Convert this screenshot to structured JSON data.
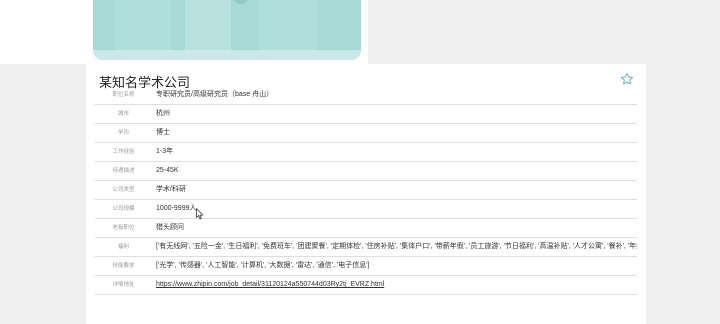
{
  "company": {
    "name": "某知名学术公司"
  },
  "colors": {
    "accent_star": "#5ab9c0",
    "hero_teal": "#a7d9d7"
  },
  "icons": {
    "favorite": "star-outline-icon",
    "cursor": "mouse-pointer-icon"
  },
  "details": [
    {
      "label": "职位名称",
      "value": "专职研究员/高级研究员（base 舟山）"
    },
    {
      "label": "城市",
      "value": "杭州"
    },
    {
      "label": "学历",
      "value": "博士"
    },
    {
      "label": "工作经验",
      "value": "1-3年"
    },
    {
      "label": "待遇描述",
      "value": "25-45K"
    },
    {
      "label": "公司类型",
      "value": "学术/科研"
    },
    {
      "label": "公司规模",
      "value": "1000-9999人"
    },
    {
      "label": "老板职位",
      "value": "猎头顾问"
    },
    {
      "label": "福利",
      "value": "['有无线网', '五险一金', '生日福利', '免费班车', '团建聚餐', '定期体检', '住房补贴', '集体户口', '带薪年假', '员工旅游', '节日福利', '高温补贴', '人才公寓', '餐补', '年终奖']"
    },
    {
      "label": "技能要求",
      "value": "['光学', '传感器', '人工智能', '计算机', '大数据', '雷达', '通信', '电子信息']"
    },
    {
      "label": "详情地址",
      "value": "https://www.zhipin.com/job_detail/31120124a550744d03Ry2tj_EVRZ.html"
    }
  ]
}
